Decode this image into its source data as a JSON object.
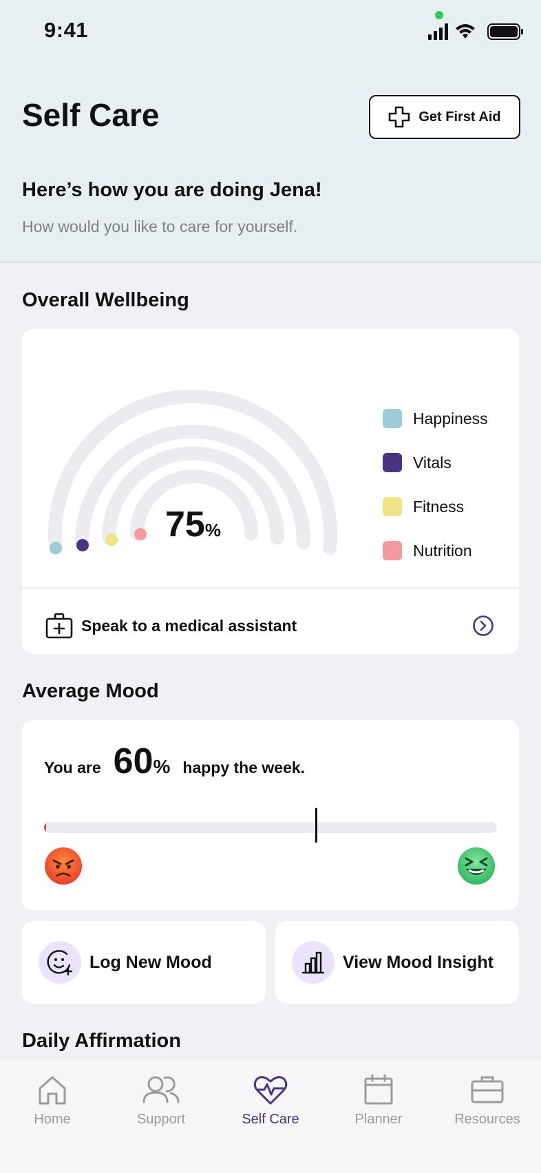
{
  "status_bar": {
    "time": "9:41"
  },
  "header": {
    "title": "Self Care",
    "first_aid_label": "Get First Aid",
    "greeting": "Here’s how you are doing Jena!",
    "subtitle": "How would you like to care for yourself."
  },
  "wellbeing": {
    "section_title": "Overall Wellbeing",
    "value": "75",
    "unit": "%",
    "legend": [
      {
        "label": "Happiness",
        "color": "#9ccdd6"
      },
      {
        "label": "Vitals",
        "color": "#4b3384"
      },
      {
        "label": "Fitness",
        "color": "#f1e187"
      },
      {
        "label": "Nutrition",
        "color": "#f4999d"
      }
    ],
    "assistant_label": "Speak to a medical assistant"
  },
  "mood": {
    "section_title": "Average Mood",
    "prefix": "You are",
    "value": "60",
    "unit": "%",
    "suffix": "happy the week.",
    "slider_level": 0.6
  },
  "actions": {
    "log_mood": "Log New Mood",
    "view_insight": "View Mood Insight"
  },
  "affirmation": {
    "section_title": "Daily Affirmation"
  },
  "tabbar": {
    "tabs": [
      {
        "label": "Home"
      },
      {
        "label": "Support"
      },
      {
        "label": "Self Care"
      },
      {
        "label": "Planner"
      },
      {
        "label": "Resources"
      }
    ],
    "active": "Self Care"
  },
  "colors": {
    "accent": "#4b3384",
    "header_bg": "#e6f0f2",
    "page_bg": "#f1f0f5"
  }
}
